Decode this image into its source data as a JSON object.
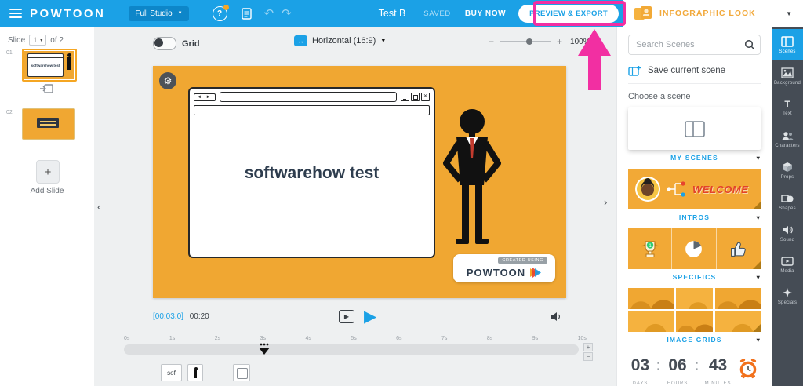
{
  "topbar": {
    "logo": "POWTOON",
    "studio_label": "Full Studio",
    "help": "?",
    "title": "Test B",
    "saved": "SAVED",
    "buy_now": "BUY NOW",
    "preview_export": "PREVIEW & EXPORT"
  },
  "look_bar": {
    "label": "INFOGRAPHIC LOOK"
  },
  "glyphs": {
    "chevron_down": "▼",
    "chevron_down_small": "▾",
    "collapse_left": "‹",
    "expand_right": "›",
    "undo": "↶",
    "redo": "↷",
    "gear": "⚙",
    "play": "▶",
    "plus": "+",
    "minus": "−",
    "nav_arrows": "◄ ►",
    "close": "✕",
    "arrows_horizontal": "↔",
    "text_tool": "T"
  },
  "slides_panel": {
    "slide_word": "Slide",
    "current": "1",
    "of_total": "of 2",
    "items": [
      {
        "number": "01",
        "preview_text": "softwarehow test"
      },
      {
        "number": "02"
      }
    ],
    "add_label": "Add Slide"
  },
  "canvas_toolbar": {
    "grid_label": "Grid",
    "orientation_label": "Horizontal (16:9)",
    "zoom_value": "100%"
  },
  "canvas": {
    "headline": "softwarehow test",
    "watermark_tag": "CREATED USING",
    "watermark_brand": "POWTOON"
  },
  "playback": {
    "elapsed": "[00:03.0]",
    "total": "00:20"
  },
  "timeline": {
    "ticks": [
      "0s",
      "1s",
      "2s",
      "3s",
      "4s",
      "5s",
      "6s",
      "7s",
      "8s",
      "9s",
      "10s"
    ],
    "chip_label": "sof"
  },
  "scenes_panel": {
    "search_placeholder": "Search Scenes",
    "save_label": "Save current scene",
    "choose_label": "Choose a scene",
    "my_scenes_label": "MY SCENES",
    "welcome_text": "WELCOME",
    "intros_label": "INTROS",
    "specifics_label": "SPECIFICS",
    "trophy_badge": "1",
    "image_grids_label": "IMAGE GRIDS",
    "timer": {
      "days": "03",
      "hours": "06",
      "minutes": "43",
      "separator": ":",
      "days_label": "DAYS",
      "hours_label": "HOURS",
      "minutes_label": "MINUTES"
    }
  },
  "right_rail": {
    "items": [
      {
        "label": "Scenes",
        "active": true
      },
      {
        "label": "Background"
      },
      {
        "label": "Text"
      },
      {
        "label": "Characters"
      },
      {
        "label": "Props"
      },
      {
        "label": "Shapes"
      },
      {
        "label": "Sound"
      },
      {
        "label": "Media"
      },
      {
        "label": "Specials"
      }
    ]
  },
  "colors": {
    "topbar_blue": "#1BA1E6",
    "canvas_orange": "#F0A732",
    "annotation_pink": "#F22FA2",
    "rail_dark": "#454C55",
    "accent_blue": "#1BA1E6",
    "welcome_red": "#E3422B",
    "infographic_gold": "#F2A93B",
    "clock_orange": "#F2711C"
  }
}
